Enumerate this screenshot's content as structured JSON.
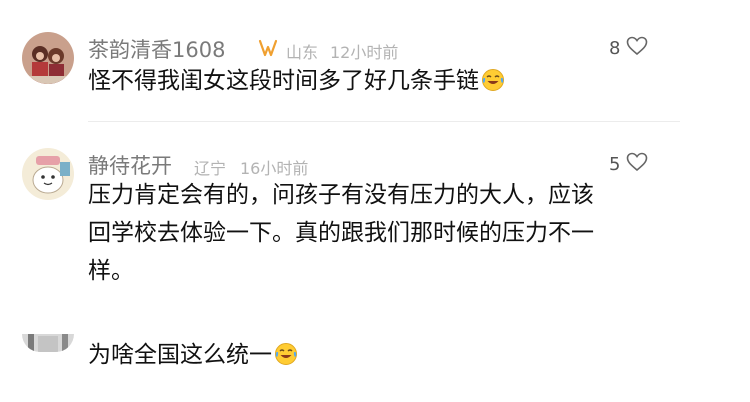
{
  "comments": [
    {
      "username": "茶韵清香1608",
      "location": "山东",
      "time": "12小时前",
      "likes": "8",
      "text_lines": [
        "怪不得我闺女这段时间多了好几条手链"
      ],
      "emoji": "laughing-crying-emoji",
      "badge_icon": "fan-badge-icon"
    },
    {
      "username": "静待花开",
      "location": "辽宁",
      "time": "16小时前",
      "likes": "5",
      "text_lines": [
        "压力肯定会有的，问孩子有没有压力的大人，应该",
        "回学校去体验一下。真的跟我们那时候的压力不一",
        "样。"
      ]
    },
    {
      "text_lines": [
        "为啥全国这么统一"
      ],
      "emoji": "laughing-crying-emoji"
    }
  ],
  "colors": {
    "username": "#7a7a7a",
    "meta": "#b3b3b3",
    "text": "#111111",
    "badge": "#f0a030"
  }
}
